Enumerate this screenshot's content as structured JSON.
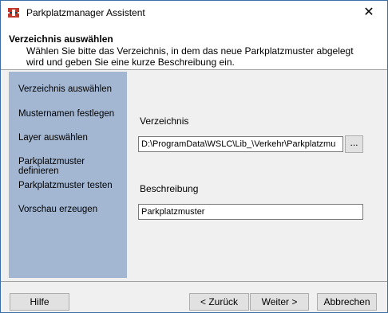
{
  "window": {
    "title": "Parkplatzmanager Assistent"
  },
  "header": {
    "title": "Verzeichnis auswählen",
    "description": "Wählen Sie bitte das Verzeichnis, in dem das neue Parkplatzmuster abgelegt wird und geben Sie eine kurze Beschreibung ein."
  },
  "steps": [
    {
      "label": "Verzeichnis auswählen"
    },
    {
      "label": "Musternamen festlegen"
    },
    {
      "label": "Layer auswählen"
    },
    {
      "label": "Parkplatzmuster definieren"
    },
    {
      "label": "Parkplatzmuster testen"
    },
    {
      "label": "Vorschau erzeugen"
    }
  ],
  "form": {
    "directory_label": "Verzeichnis",
    "directory_value": "D:\\ProgramData\\WSLC\\Lib_\\Verkehr\\Parkplatzmu",
    "browse_label": "...",
    "description_label": "Beschreibung",
    "description_value": "Parkplatzmuster"
  },
  "buttons": {
    "help": "Hilfe",
    "back": "< Zurück",
    "next": "Weiter >",
    "cancel": "Abbrechen"
  },
  "icons": {
    "app": "app-icon",
    "close": "close-icon"
  },
  "colors": {
    "steps_panel": "#a3b7d3",
    "window_border": "#3a6ea5"
  }
}
